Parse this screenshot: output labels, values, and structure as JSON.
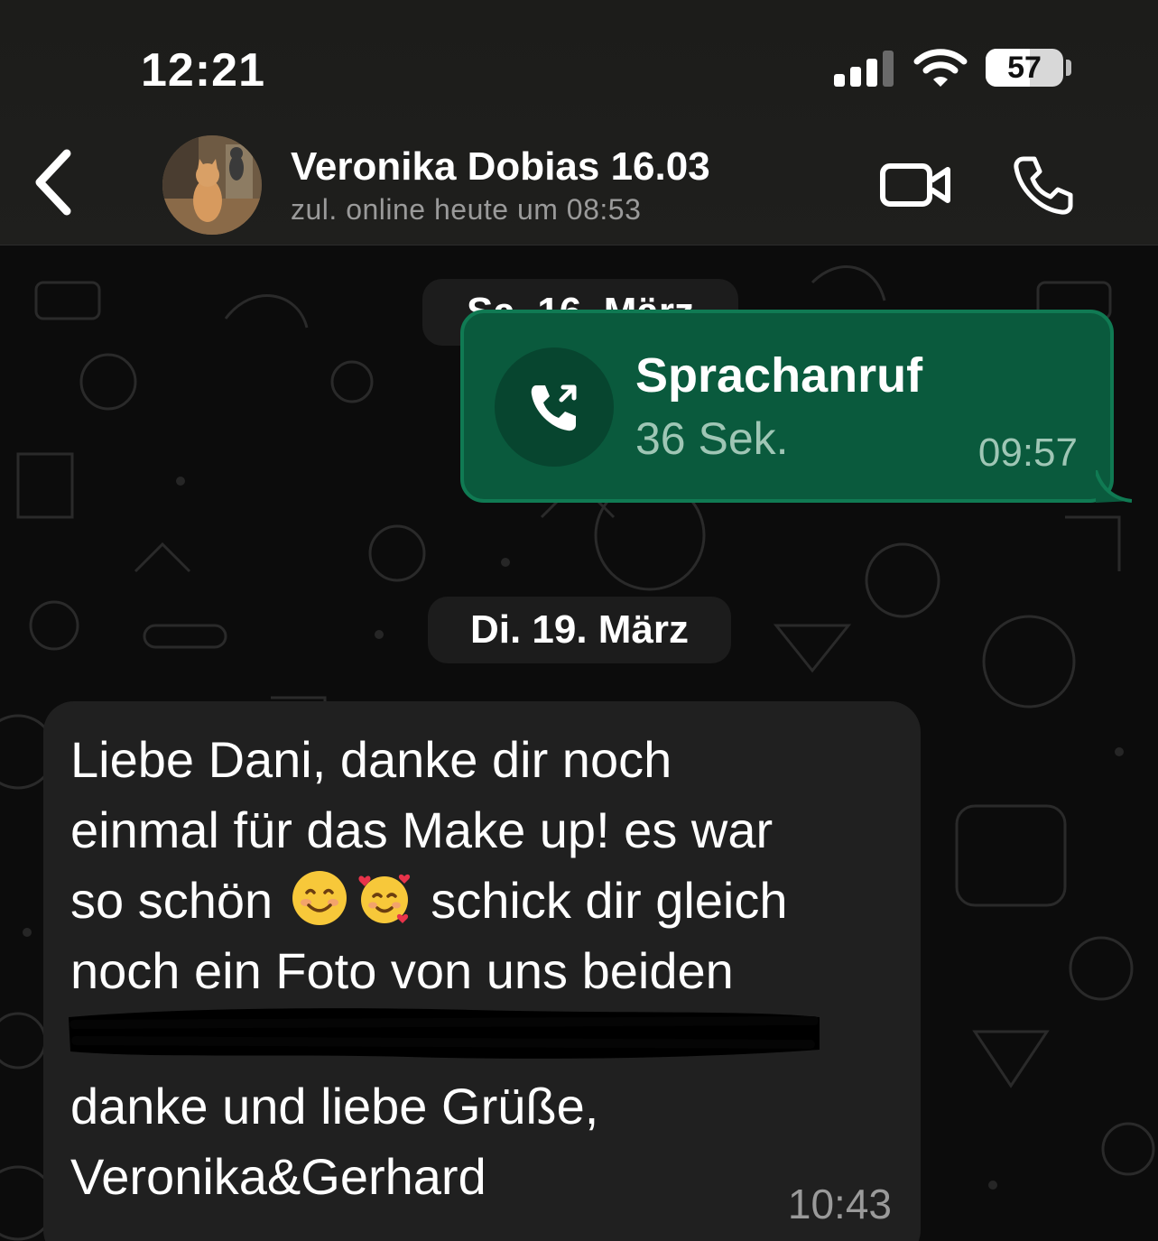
{
  "status_bar": {
    "time": "12:21",
    "battery_percent": "57",
    "battery_level": 0.57,
    "signal_bars": 3
  },
  "header": {
    "back_icon": "chevron-left-icon",
    "contact_name": "Veronika Dobias 16.03",
    "contact_status": "zul. online heute um 08:53",
    "video_icon": "video-camera-icon",
    "call_icon": "phone-icon"
  },
  "chat": {
    "date_separators": [
      "Sa. 16. März",
      "Di. 19. März"
    ],
    "call_message": {
      "title": "Sprachanruf",
      "duration": "36 Sek.",
      "time": "09:57",
      "icon": "outgoing-call-icon"
    },
    "text_message": {
      "line_1": "Liebe Dani, danke dir noch\neinmal für das Make up! es war\nso schön ",
      "emoji_1": "smiling-face-emoji",
      "emoji_2": "smiling-face-with-hearts-emoji",
      "line_2": " schick dir gleich\nnoch ein Foto von uns beiden",
      "signature": "danke und liebe Grüße,\nVeronika&Gerhard",
      "time": "10:43"
    }
  },
  "colors": {
    "outgoing_bubble": "#0a5a3d",
    "incoming_bubble": "#202020",
    "background": "#0c0c0c"
  }
}
